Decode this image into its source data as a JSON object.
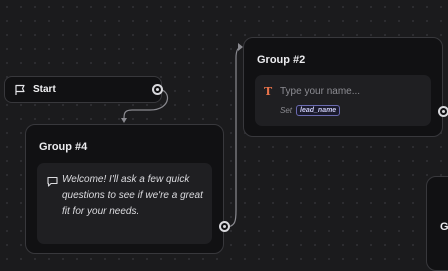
{
  "start": {
    "label": "Start"
  },
  "groups": {
    "group4": {
      "title": "Group #4",
      "message": "Welcome! I'll ask a few quick questions to see if we're a great fit for your needs."
    },
    "group2": {
      "title": "Group #2",
      "input_placeholder": "Type your name...",
      "set_label": "Set",
      "variable": "lead_name"
    },
    "partial": {
      "title": "G"
    }
  },
  "colors": {
    "canvas": "#1b1b1d",
    "node": "#111113",
    "block": "#1f1f22",
    "edge": "#8a8a90",
    "text_icon": "#e8734a",
    "variable_chip": "#6b6bb0"
  }
}
